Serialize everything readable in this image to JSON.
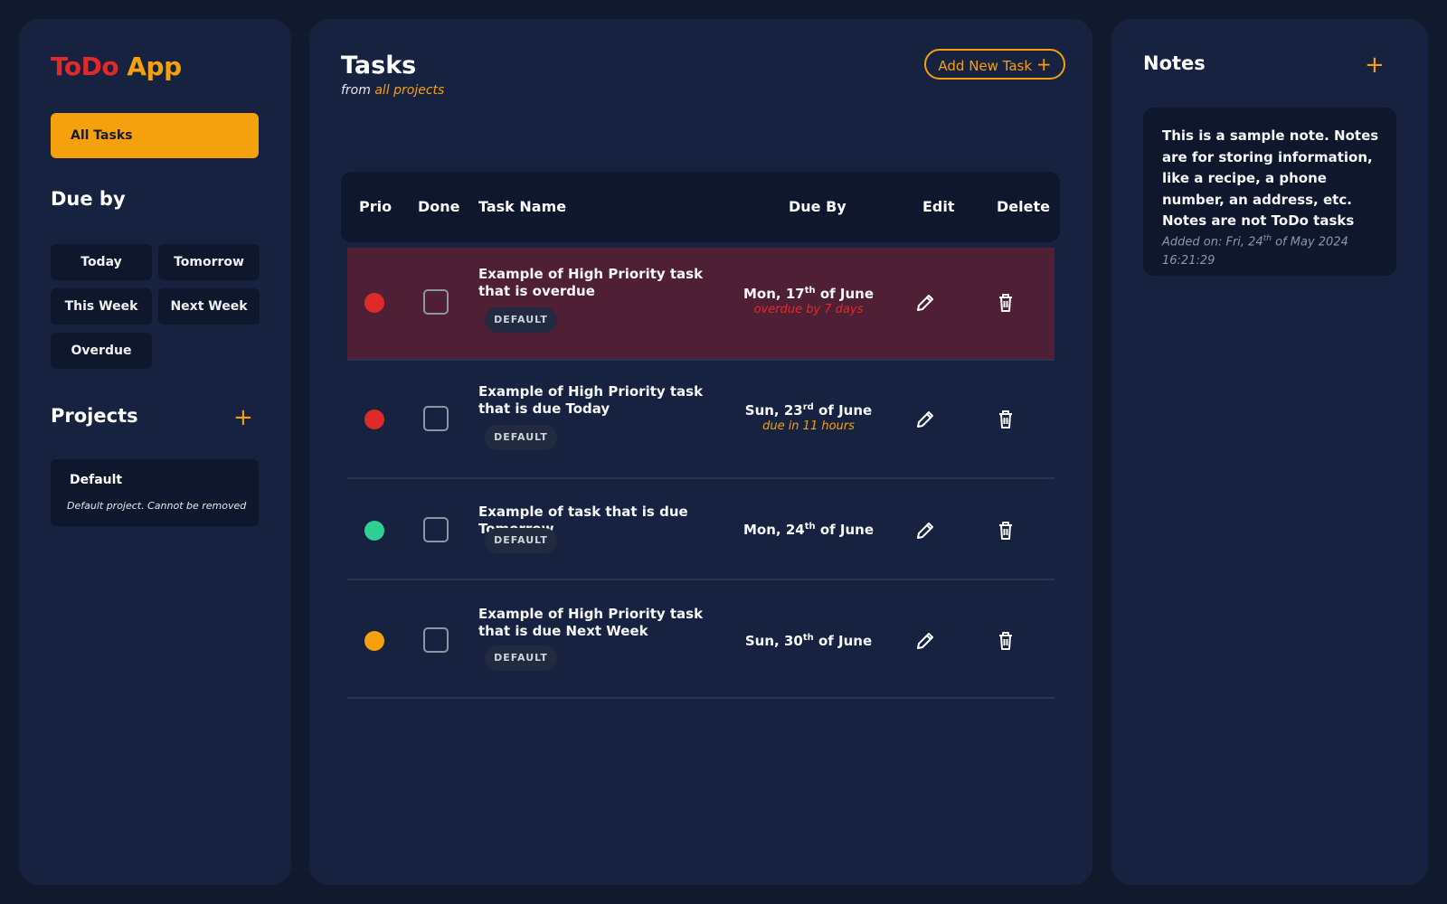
{
  "sidebar": {
    "logo_part1": "ToDo",
    "logo_part2": "App",
    "all_tasks_label": "All Tasks",
    "due_by_title": "Due by",
    "due_buttons": [
      "Today",
      "Tomorrow",
      "This Week",
      "Next Week",
      "Overdue"
    ],
    "projects_title": "Projects",
    "add_project_icon": "plus-icon",
    "projects": [
      {
        "name": "Default",
        "description": "Default project. Cannot be removed"
      }
    ]
  },
  "main": {
    "title": "Tasks",
    "subtitle_prefix": "from",
    "subtitle_accent": "all projects",
    "add_task_label": "Add New Task",
    "columns": [
      "Prio",
      "Done",
      "Task Name",
      "Due By",
      "Edit",
      "Delete"
    ],
    "tasks": [
      {
        "name": "Example of High Priority task that is overdue",
        "tag": "DEFAULT",
        "due_day": "Mon, 17",
        "due_suffix": "th",
        "due_month": " of June",
        "due_note": "overdue by 7 days",
        "due_note_color": "#e02a2a",
        "prio_color": "#e02a2a",
        "overdue": true
      },
      {
        "name": "Example of High Priority task that is due Today",
        "tag": "DEFAULT",
        "due_day": "Sun, 23",
        "due_suffix": "rd",
        "due_month": " of June",
        "due_note": "due in 11 hours",
        "due_note_color": "#f4a10d",
        "prio_color": "#e02a2a",
        "overdue": false
      },
      {
        "name": "Example of task that is due Tomorrow",
        "tag": "DEFAULT",
        "due_day": "Mon, 24",
        "due_suffix": "th",
        "due_month": " of June",
        "due_note": "",
        "prio_color": "#2fcf96",
        "overdue": false
      },
      {
        "name": "Example of High Priority task that is due Next Week",
        "tag": "DEFAULT",
        "due_day": "Sun, 30",
        "due_suffix": "th",
        "due_month": " of June",
        "due_note": "",
        "prio_color": "#f4a10d",
        "overdue": false
      }
    ]
  },
  "notes": {
    "title": "Notes",
    "add_note_icon": "plus-icon",
    "items": [
      {
        "text": "This is a sample note. Notes are for storing information, like a recipe, a phone number, an address, etc. Notes are not ToDo tasks",
        "added_prefix": "Added on: Fri, 24",
        "added_suffix": "th",
        "added_rest": " of May 2024 16:21:29"
      }
    ]
  },
  "colors": {
    "accent": "#f4a10d",
    "danger": "#e02a2a",
    "success": "#2fcf96",
    "panel": "#172240",
    "background": "#111a2c"
  }
}
